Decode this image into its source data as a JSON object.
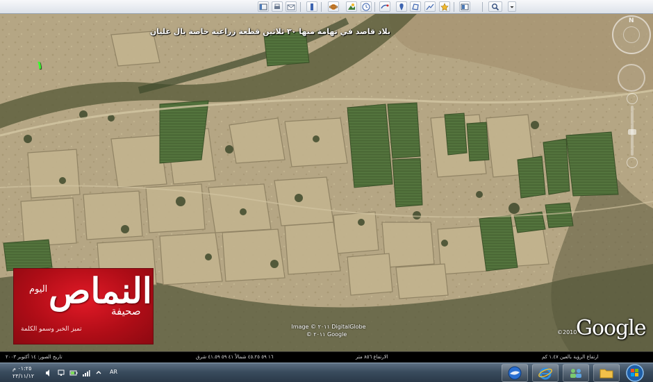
{
  "toolbar": {
    "buttons": [
      "sidebar-toggle-icon",
      "print-icon",
      "email-icon",
      "ruler-icon",
      "planet-icon",
      "sunlight-icon",
      "historical-imagery-icon",
      "tour-icon",
      "add-placemark-icon",
      "add-polygon-icon",
      "add-path-icon",
      "add-overlay-icon",
      "view-toggle-icon",
      "search-icon",
      "dropdown-icon"
    ]
  },
  "map": {
    "title": "بلاد قاصد في تهامة منها ٣٠ ثلاثين قطعة زراعية خاصة بال عليان",
    "marker_label": "١",
    "compass_n": "N",
    "credit_line1": "Image © ٢٠١١ DigitalGlobe",
    "credit_line2": "© ٢٠١١ Google",
    "google_year": "©2010",
    "google_logo": "Google"
  },
  "logo": {
    "name": "النماص",
    "today": "اليوم",
    "paper": "صحيفة",
    "slogan": "تميز الخبر وسمو الكلمة"
  },
  "status": {
    "imagery_date": "تاريخ الصور: ١٤ أكتوبر ٢٠٠٣",
    "coords": "١٦ ٥٩ ٤٥.٢٥ شمالاً  ٤١ ٥٩ ٤١.٥٩ شرق",
    "elevation": "الارتفاع ٨٥٦ متر",
    "eye_altitude": "ارتفاع الرؤية بالعين ١.٤٧ كم"
  },
  "taskbar": {
    "time": "٠١:٢٥ م",
    "date": "٢٣/١١/١٢",
    "lang": "AR",
    "apps": [
      "google-earth-icon",
      "internet-explorer-icon",
      "network-icon",
      "folder-icon"
    ]
  },
  "colors": {
    "logo_red": "#c4101b",
    "map_tan": "#b8a887",
    "crop_green": "#4e6a38",
    "taskbar": "#3a4c5e"
  }
}
